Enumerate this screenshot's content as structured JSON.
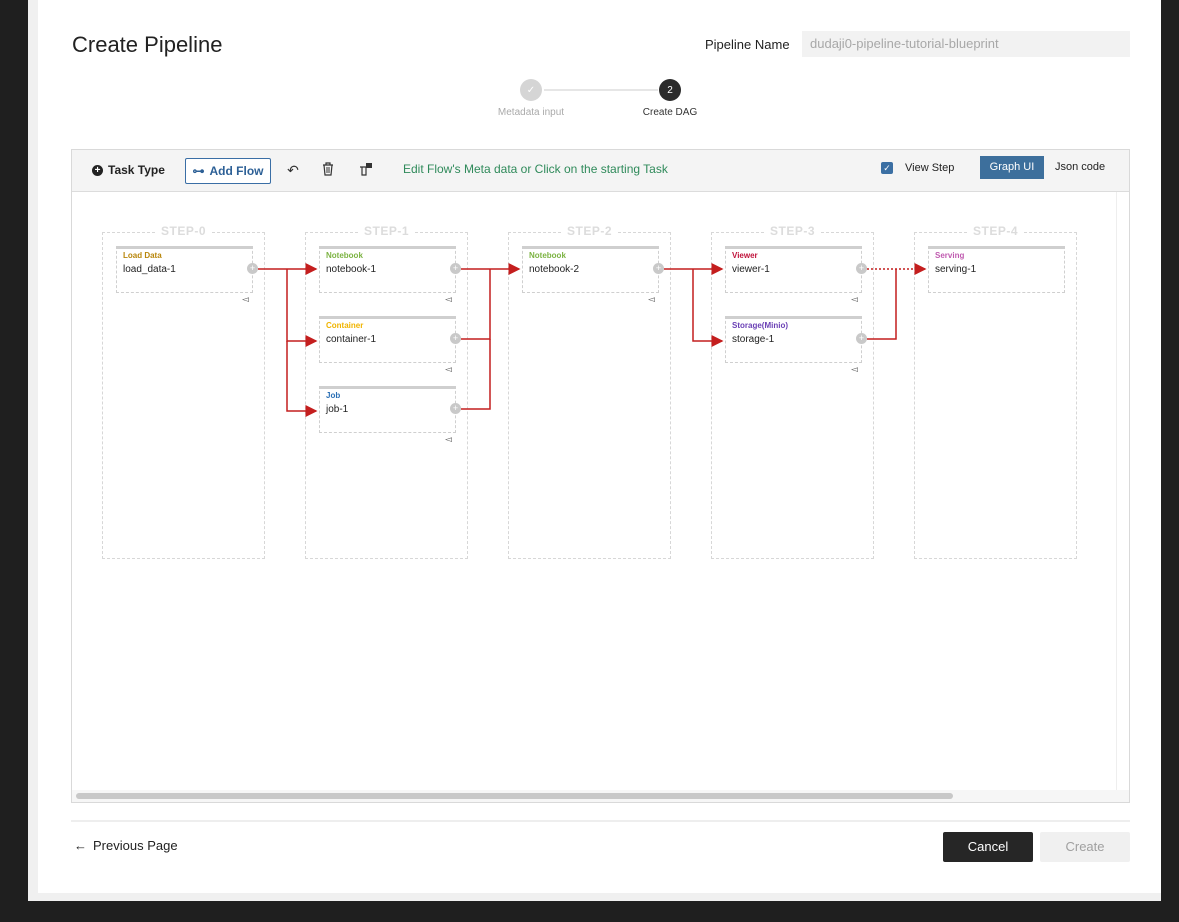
{
  "header": {
    "title": "Create Pipeline",
    "pipeline_name_label": "Pipeline Name",
    "pipeline_name_value": "dudaji0-pipeline-tutorial-blueprint"
  },
  "stepper": {
    "steps": [
      {
        "label": "Metadata input",
        "done": true
      },
      {
        "label": "Create DAG",
        "number": "2",
        "active": true
      }
    ]
  },
  "toolbar": {
    "task_type": "Task Type",
    "add_flow": "Add Flow",
    "message": "Edit Flow's Meta data or Click on the starting Task",
    "view_step_label": "View Step",
    "view_step_checked": true,
    "graph_ui": "Graph UI",
    "json_code": "Json code"
  },
  "dag": {
    "steps": [
      "STEP-0",
      "STEP-1",
      "STEP-2",
      "STEP-3",
      "STEP-4"
    ],
    "nodes": [
      {
        "type": "Load Data",
        "name": "load_data-1",
        "color": "#b8860b"
      },
      {
        "type": "Notebook",
        "name": "notebook-1",
        "color": "#7cb342"
      },
      {
        "type": "Container",
        "name": "container-1",
        "color": "#f0b400"
      },
      {
        "type": "Job",
        "name": "job-1",
        "color": "#2a6fb5"
      },
      {
        "type": "Notebook",
        "name": "notebook-2",
        "color": "#7cb342"
      },
      {
        "type": "Viewer",
        "name": "viewer-1",
        "color": "#c0143c"
      },
      {
        "type": "Storage(Minio)",
        "name": "storage-1",
        "color": "#6a3fb5"
      },
      {
        "type": "Serving",
        "name": "serving-1",
        "color": "#c05bb0"
      }
    ],
    "edge_color": "#c41e1e"
  },
  "footer": {
    "previous": "Previous Page",
    "cancel": "Cancel",
    "create": "Create"
  }
}
